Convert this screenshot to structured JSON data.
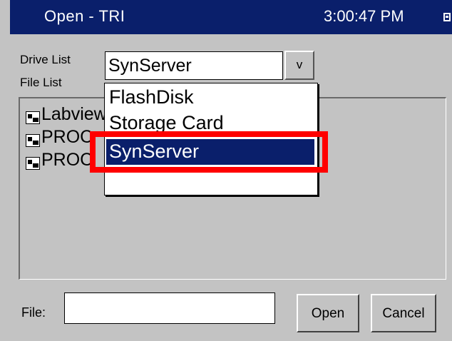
{
  "window": {
    "title": "Open - TRI",
    "clock": "3:00:47 PM"
  },
  "drive": {
    "label": "Drive List",
    "selected": "SynServer",
    "button_label": "v",
    "options": [
      "FlashDisk",
      "Storage Card",
      "SynServer"
    ]
  },
  "file_list": {
    "label": "File List",
    "items": [
      "Labview",
      "PROC",
      "PROC"
    ]
  },
  "file": {
    "label": "File:",
    "value": ""
  },
  "buttons": {
    "open": "Open",
    "cancel": "Cancel"
  },
  "colors": {
    "titlebar": "#0a1f6b",
    "background": "#c3c3c3",
    "highlight": "#ff0000"
  }
}
